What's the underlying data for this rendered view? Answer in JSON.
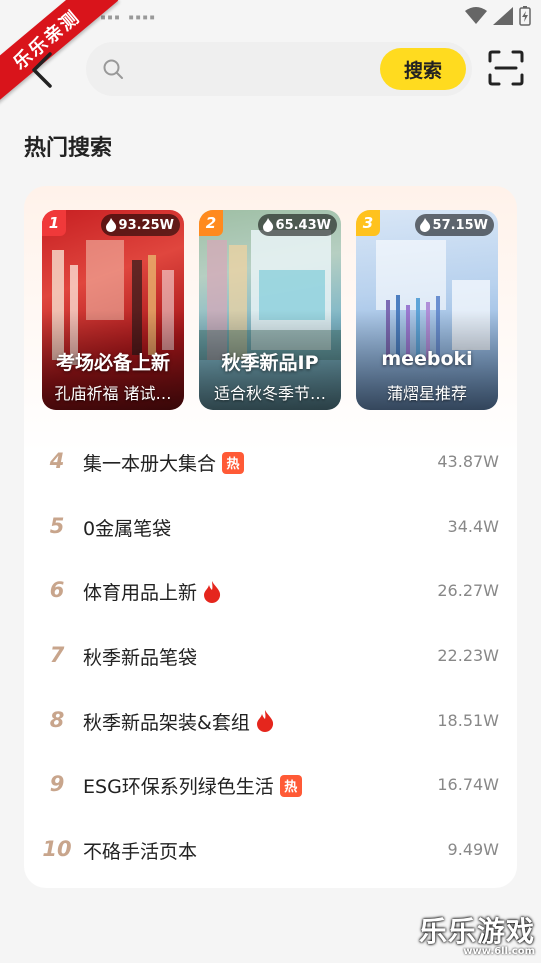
{
  "status_bar": {
    "dots": "▪▪▪ ▪▪▪▪"
  },
  "ribbon": {
    "text": "乐乐亲测"
  },
  "search": {
    "placeholder": "",
    "button_label": "搜索"
  },
  "section": {
    "title": "热门搜索"
  },
  "top3": [
    {
      "rank": "1",
      "heat": "93.25W",
      "title": "考场必备上新",
      "subtitle": "孔庙祈福 诸试…",
      "badge_color": "#f0393a"
    },
    {
      "rank": "2",
      "heat": "65.43W",
      "title": "秋季新品IP",
      "subtitle": "适合秋冬季节…",
      "badge_color": "#ff8a1e"
    },
    {
      "rank": "3",
      "heat": "57.15W",
      "title": "meeboki",
      "subtitle": "蒲熠星推荐",
      "badge_color": "#ffc21e"
    }
  ],
  "list": [
    {
      "rank": "4",
      "label": "集一本册大集合",
      "tag": "hot-text",
      "tag_text": "热",
      "value": "43.87W"
    },
    {
      "rank": "5",
      "label": "0金属笔袋",
      "tag": "",
      "tag_text": "",
      "value": "34.4W"
    },
    {
      "rank": "6",
      "label": "体育用品上新",
      "tag": "fire",
      "tag_text": "",
      "value": "26.27W"
    },
    {
      "rank": "7",
      "label": "秋季新品笔袋",
      "tag": "",
      "tag_text": "",
      "value": "22.23W"
    },
    {
      "rank": "8",
      "label": "秋季新品架装&套组",
      "tag": "fire",
      "tag_text": "",
      "value": "18.51W"
    },
    {
      "rank": "9",
      "label": "ESG环保系列绿色生活",
      "tag": "hot-text",
      "tag_text": "热",
      "value": "16.74W"
    },
    {
      "rank": "10",
      "label": "不硌手活页本",
      "tag": "",
      "tag_text": "",
      "value": "9.49W"
    }
  ],
  "watermark": {
    "brand": "乐乐游戏",
    "url": "www.6ll.com"
  },
  "colors": {
    "accent": "#ffdb1f",
    "rank_color": "#c8a58c",
    "fire": "#e5261d"
  }
}
